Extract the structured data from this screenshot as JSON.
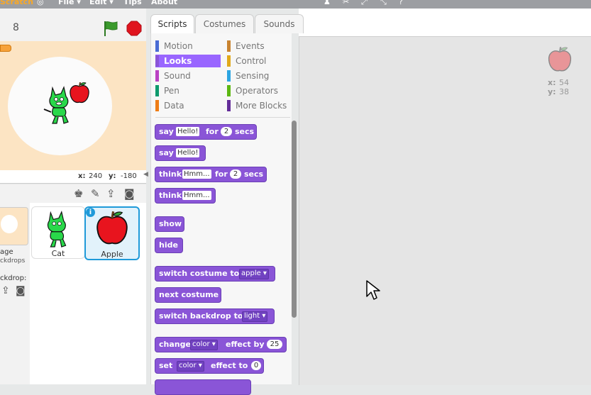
{
  "menu": {
    "logo": "Scratch",
    "items": [
      "File ▾",
      "Edit ▾",
      "Tips",
      "About"
    ]
  },
  "stage": {
    "version": "8",
    "coords": {
      "x_label": "x:",
      "x": "240",
      "y_label": "y:",
      "y": "-180"
    }
  },
  "sprite_pane": {
    "stage_thumb_label_1": "age",
    "stage_thumb_label_2": "ckdrops",
    "new_backdrop_label": "ckdrop:",
    "sprites": [
      {
        "name": "Cat",
        "selected": false
      },
      {
        "name": "Apple",
        "selected": true
      }
    ],
    "info_badge": "i"
  },
  "tabs": [
    "Scripts",
    "Costumes",
    "Sounds"
  ],
  "categories": [
    {
      "label": "Motion",
      "color": "#4a6cd4"
    },
    {
      "label": "Events",
      "color": "#c88330"
    },
    {
      "label": "Looks",
      "color": "#8a55d7"
    },
    {
      "label": "Control",
      "color": "#e1a91a"
    },
    {
      "label": "Sound",
      "color": "#bb42c3"
    },
    {
      "label": "Sensing",
      "color": "#2ca5e2"
    },
    {
      "label": "Pen",
      "color": "#0e9a6c"
    },
    {
      "label": "Operators",
      "color": "#5cb712"
    },
    {
      "label": "Data",
      "color": "#ee7d16"
    },
    {
      "label": "More Blocks",
      "color": "#632d99"
    }
  ],
  "blocks": {
    "say_for": {
      "t1": "say",
      "s1": "Hello!",
      "t2": "for",
      "s2": "2",
      "t3": "secs"
    },
    "say": {
      "t1": "say",
      "s1": "Hello!"
    },
    "think_for": {
      "t1": "think",
      "s1": "Hmm...",
      "t2": "for",
      "s2": "2",
      "t3": "secs"
    },
    "think": {
      "t1": "think",
      "s1": "Hmm..."
    },
    "show": {
      "t1": "show"
    },
    "hide": {
      "t1": "hide"
    },
    "switch_costume": {
      "t1": "switch costume to",
      "d1": "apple ▾"
    },
    "next_costume": {
      "t1": "next costume"
    },
    "switch_backdrop": {
      "t1": "switch backdrop to",
      "d1": "light ▾"
    },
    "change_effect": {
      "t1": "change",
      "d1": "color ▾",
      "t2": "effect by",
      "s1": "25"
    },
    "set_effect": {
      "t1": "set",
      "d1": "color ▾",
      "t2": "effect to",
      "s1": "0"
    }
  },
  "sprite_info": {
    "x_label": "x:",
    "x": "54",
    "y_label": "y:",
    "y": "38"
  },
  "colors": {
    "looks": "#8a55d7",
    "selected_border": "#1f9ad9",
    "stage_bg": "#fce4c3"
  }
}
